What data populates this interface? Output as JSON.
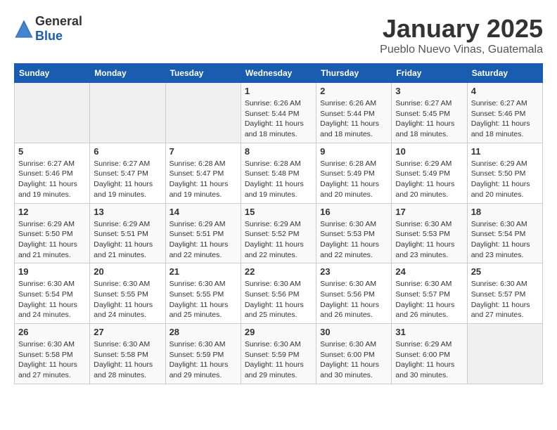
{
  "header": {
    "logo_general": "General",
    "logo_blue": "Blue",
    "month_title": "January 2025",
    "subtitle": "Pueblo Nuevo Vinas, Guatemala"
  },
  "calendar": {
    "days_of_week": [
      "Sunday",
      "Monday",
      "Tuesday",
      "Wednesday",
      "Thursday",
      "Friday",
      "Saturday"
    ],
    "weeks": [
      [
        {
          "day": "",
          "info": ""
        },
        {
          "day": "",
          "info": ""
        },
        {
          "day": "",
          "info": ""
        },
        {
          "day": "1",
          "info": "Sunrise: 6:26 AM\nSunset: 5:44 PM\nDaylight: 11 hours\nand 18 minutes."
        },
        {
          "day": "2",
          "info": "Sunrise: 6:26 AM\nSunset: 5:44 PM\nDaylight: 11 hours\nand 18 minutes."
        },
        {
          "day": "3",
          "info": "Sunrise: 6:27 AM\nSunset: 5:45 PM\nDaylight: 11 hours\nand 18 minutes."
        },
        {
          "day": "4",
          "info": "Sunrise: 6:27 AM\nSunset: 5:46 PM\nDaylight: 11 hours\nand 18 minutes."
        }
      ],
      [
        {
          "day": "5",
          "info": "Sunrise: 6:27 AM\nSunset: 5:46 PM\nDaylight: 11 hours\nand 19 minutes."
        },
        {
          "day": "6",
          "info": "Sunrise: 6:27 AM\nSunset: 5:47 PM\nDaylight: 11 hours\nand 19 minutes."
        },
        {
          "day": "7",
          "info": "Sunrise: 6:28 AM\nSunset: 5:47 PM\nDaylight: 11 hours\nand 19 minutes."
        },
        {
          "day": "8",
          "info": "Sunrise: 6:28 AM\nSunset: 5:48 PM\nDaylight: 11 hours\nand 19 minutes."
        },
        {
          "day": "9",
          "info": "Sunrise: 6:28 AM\nSunset: 5:49 PM\nDaylight: 11 hours\nand 20 minutes."
        },
        {
          "day": "10",
          "info": "Sunrise: 6:29 AM\nSunset: 5:49 PM\nDaylight: 11 hours\nand 20 minutes."
        },
        {
          "day": "11",
          "info": "Sunrise: 6:29 AM\nSunset: 5:50 PM\nDaylight: 11 hours\nand 20 minutes."
        }
      ],
      [
        {
          "day": "12",
          "info": "Sunrise: 6:29 AM\nSunset: 5:50 PM\nDaylight: 11 hours\nand 21 minutes."
        },
        {
          "day": "13",
          "info": "Sunrise: 6:29 AM\nSunset: 5:51 PM\nDaylight: 11 hours\nand 21 minutes."
        },
        {
          "day": "14",
          "info": "Sunrise: 6:29 AM\nSunset: 5:51 PM\nDaylight: 11 hours\nand 22 minutes."
        },
        {
          "day": "15",
          "info": "Sunrise: 6:29 AM\nSunset: 5:52 PM\nDaylight: 11 hours\nand 22 minutes."
        },
        {
          "day": "16",
          "info": "Sunrise: 6:30 AM\nSunset: 5:53 PM\nDaylight: 11 hours\nand 22 minutes."
        },
        {
          "day": "17",
          "info": "Sunrise: 6:30 AM\nSunset: 5:53 PM\nDaylight: 11 hours\nand 23 minutes."
        },
        {
          "day": "18",
          "info": "Sunrise: 6:30 AM\nSunset: 5:54 PM\nDaylight: 11 hours\nand 23 minutes."
        }
      ],
      [
        {
          "day": "19",
          "info": "Sunrise: 6:30 AM\nSunset: 5:54 PM\nDaylight: 11 hours\nand 24 minutes."
        },
        {
          "day": "20",
          "info": "Sunrise: 6:30 AM\nSunset: 5:55 PM\nDaylight: 11 hours\nand 24 minutes."
        },
        {
          "day": "21",
          "info": "Sunrise: 6:30 AM\nSunset: 5:55 PM\nDaylight: 11 hours\nand 25 minutes."
        },
        {
          "day": "22",
          "info": "Sunrise: 6:30 AM\nSunset: 5:56 PM\nDaylight: 11 hours\nand 25 minutes."
        },
        {
          "day": "23",
          "info": "Sunrise: 6:30 AM\nSunset: 5:56 PM\nDaylight: 11 hours\nand 26 minutes."
        },
        {
          "day": "24",
          "info": "Sunrise: 6:30 AM\nSunset: 5:57 PM\nDaylight: 11 hours\nand 26 minutes."
        },
        {
          "day": "25",
          "info": "Sunrise: 6:30 AM\nSunset: 5:57 PM\nDaylight: 11 hours\nand 27 minutes."
        }
      ],
      [
        {
          "day": "26",
          "info": "Sunrise: 6:30 AM\nSunset: 5:58 PM\nDaylight: 11 hours\nand 27 minutes."
        },
        {
          "day": "27",
          "info": "Sunrise: 6:30 AM\nSunset: 5:58 PM\nDaylight: 11 hours\nand 28 minutes."
        },
        {
          "day": "28",
          "info": "Sunrise: 6:30 AM\nSunset: 5:59 PM\nDaylight: 11 hours\nand 29 minutes."
        },
        {
          "day": "29",
          "info": "Sunrise: 6:30 AM\nSunset: 5:59 PM\nDaylight: 11 hours\nand 29 minutes."
        },
        {
          "day": "30",
          "info": "Sunrise: 6:30 AM\nSunset: 6:00 PM\nDaylight: 11 hours\nand 30 minutes."
        },
        {
          "day": "31",
          "info": "Sunrise: 6:29 AM\nSunset: 6:00 PM\nDaylight: 11 hours\nand 30 minutes."
        },
        {
          "day": "",
          "info": ""
        }
      ]
    ]
  }
}
